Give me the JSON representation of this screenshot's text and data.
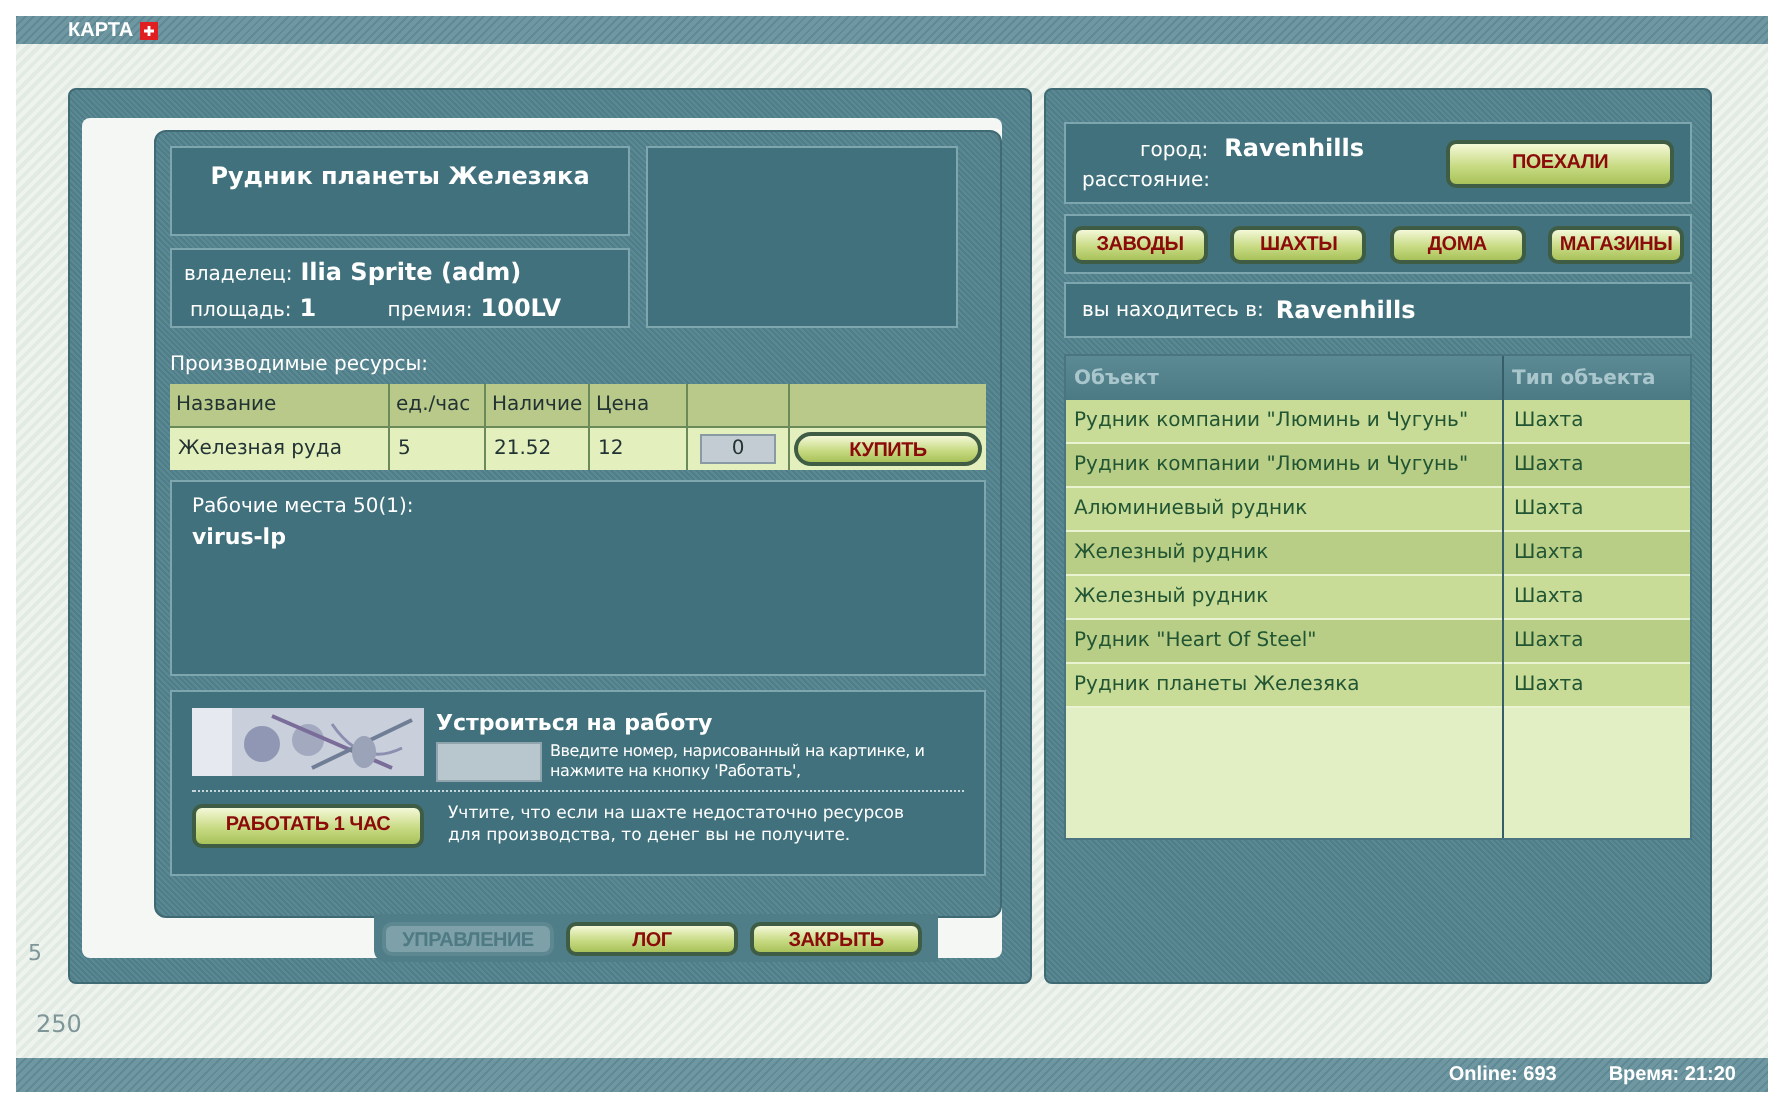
{
  "top_bar": {
    "title": "КАРТА"
  },
  "mine": {
    "title": "Рудник планеты Железяка",
    "owner_label": "владелец:",
    "owner": "Ilia Sprite (adm)",
    "area_label": "площадь:",
    "area": "1",
    "bonus_label": "премия:",
    "bonus": "100LV"
  },
  "resources": {
    "caption": "Производимые ресурсы:",
    "columns": [
      "Название",
      "ед./час",
      "Наличие",
      "Цена"
    ],
    "rows": [
      {
        "name": "Железная руда",
        "per_hour": "5",
        "stock": "21.52",
        "price": "12",
        "quantity": "0",
        "button": "КУПИТЬ"
      }
    ]
  },
  "workers": {
    "caption": "Рабочие места 50(1):",
    "names": [
      "virus-lp"
    ]
  },
  "job": {
    "title": "Устроиться на работу",
    "hint": "Введите номер, нарисованный на картинке, и нажмите на кнопку 'Работать',",
    "button": "РАБОТАТЬ 1 ЧАС",
    "note": "Учтите, что если на шахте недостаточно ресурсов для производства, то денег вы не получите."
  },
  "bottom_buttons": [
    {
      "label": "УПРАВЛЕНИЕ",
      "disabled": true
    },
    {
      "label": "ЛОГ",
      "disabled": false
    },
    {
      "label": "ЗАКРЫТЬ",
      "disabled": false
    }
  ],
  "travel": {
    "city_label": "город:",
    "city": "Ravenhills",
    "distance_label": "расстояние:",
    "button": "ПОЕХАЛИ"
  },
  "categories": [
    "ЗАВОДЫ",
    "ШАХТЫ",
    "ДОМА",
    "МАГАЗИНЫ"
  ],
  "location": {
    "label": "вы находитесь в:",
    "city": "Ravenhills"
  },
  "objects": {
    "columns": [
      "Объект",
      "Тип объекта"
    ],
    "rows": [
      {
        "name": "Рудник компании \"Люминь и Чугунь\"",
        "type": "Шахта"
      },
      {
        "name": "Рудник компании \"Люминь и Чугунь\"",
        "type": "Шахта"
      },
      {
        "name": "Алюминиевый рудник",
        "type": "Шахта"
      },
      {
        "name": "Железный рудник",
        "type": "Шахта"
      },
      {
        "name": "Железный рудник",
        "type": "Шахта"
      },
      {
        "name": "Рудник \"Heart Of Steel\"",
        "type": "Шахта"
      },
      {
        "name": "Рудник планеты Железяка",
        "type": "Шахта"
      }
    ]
  },
  "decor_marks": [
    "5",
    "250"
  ],
  "status_bar": {
    "online": "Online: 693",
    "time": "Время: 21:20"
  }
}
